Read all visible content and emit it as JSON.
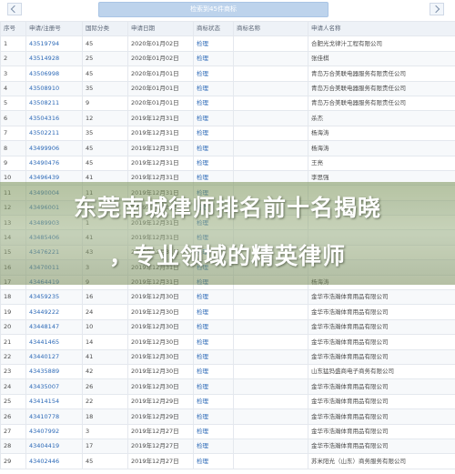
{
  "search_banner": "检索到45件商标",
  "table": {
    "headers": [
      "序号",
      "申请/注册号",
      "国际分类",
      "申请日期",
      "商标状态",
      "商标名称",
      "申请人名称"
    ],
    "rows": [
      [
        "1",
        "43519794",
        "45",
        "2020年01月02日",
        "检理",
        "",
        "合肥光戈律汁工程有限公司"
      ],
      [
        "2",
        "43514928",
        "25",
        "2020年01月02日",
        "检理",
        "",
        "张佳棋"
      ],
      [
        "3",
        "43506998",
        "45",
        "2020年01月01日",
        "检理",
        "",
        "青岛万合美联电器服务有限责任公司"
      ],
      [
        "4",
        "43508910",
        "35",
        "2020年01月01日",
        "检理",
        "",
        "青岛万合美联电器服务有限责任公司"
      ],
      [
        "5",
        "43508211",
        "9",
        "2020年01月01日",
        "检理",
        "",
        "青岛万合美联电器服务有限责任公司"
      ],
      [
        "6",
        "43504316",
        "12",
        "2019年12月31日",
        "检理",
        "",
        "杀杰"
      ],
      [
        "7",
        "43502211",
        "35",
        "2019年12月31日",
        "检理",
        "",
        "杨海涛"
      ],
      [
        "8",
        "43499906",
        "45",
        "2019年12月31日",
        "检理",
        "",
        "杨海涛"
      ],
      [
        "9",
        "43490476",
        "45",
        "2019年12月31日",
        "检理",
        "",
        "王亮"
      ],
      [
        "10",
        "43496439",
        "41",
        "2019年12月31日",
        "检理",
        "",
        "李思强"
      ],
      [
        "11",
        "43490004",
        "11",
        "2019年12月31日",
        "检理",
        "",
        ""
      ],
      [
        "12",
        "43496001",
        "20",
        "2019年12月31日",
        "检理",
        "",
        ""
      ],
      [
        "13",
        "43489903",
        "1",
        "2019年12月31日",
        "检理",
        "",
        ""
      ],
      [
        "14",
        "43485406",
        "41",
        "2019年12月31日",
        "检理",
        "",
        ""
      ],
      [
        "15",
        "43476221",
        "43",
        "2019年12月31日",
        "检理",
        "",
        ""
      ],
      [
        "16",
        "43470011",
        "3",
        "2019年12月31日",
        "检理",
        "",
        ""
      ],
      [
        "17",
        "43464419",
        "9",
        "2019年12月31日",
        "检理",
        "",
        "杨海涛"
      ],
      [
        "18",
        "43459235",
        "16",
        "2019年12月30日",
        "检理",
        "",
        "金华市浩瀚体育用品有限公司"
      ],
      [
        "19",
        "43449222",
        "24",
        "2019年12月30日",
        "检理",
        "",
        "金华市浩瀚体育用品有限公司"
      ],
      [
        "20",
        "43448147",
        "10",
        "2019年12月30日",
        "检理",
        "",
        "金华市浩瀚体育用品有限公司"
      ],
      [
        "21",
        "43441465",
        "14",
        "2019年12月30日",
        "检理",
        "",
        "金华市浩瀚体育用品有限公司"
      ],
      [
        "22",
        "43440127",
        "41",
        "2019年12月30日",
        "检理",
        "",
        "金华市浩瀚体育用品有限公司"
      ],
      [
        "23",
        "43435889",
        "42",
        "2019年12月30日",
        "检理",
        "",
        "山东猛犸盛商电子商务有限公司"
      ],
      [
        "24",
        "43435007",
        "26",
        "2019年12月30日",
        "检理",
        "",
        "金华市浩瀚体育用品有限公司"
      ],
      [
        "25",
        "43414154",
        "22",
        "2019年12月29日",
        "检理",
        "",
        "金华市浩瀚体育用品有限公司"
      ],
      [
        "26",
        "43410778",
        "18",
        "2019年12月29日",
        "检理",
        "",
        "金华市浩瀚体育用品有限公司"
      ],
      [
        "27",
        "43407992",
        "3",
        "2019年12月27日",
        "检理",
        "",
        "金华市浩瀚体育用品有限公司"
      ],
      [
        "28",
        "43404419",
        "17",
        "2019年12月27日",
        "检理",
        "",
        "金华市浩瀚体育用品有限公司"
      ],
      [
        "29",
        "43402446",
        "45",
        "2019年12月27日",
        "检理",
        "",
        "苏米阳光（山东）商务服务有限公司"
      ]
    ]
  },
  "headline": {
    "line1": "东莞南城律师排名前十名揭晓",
    "line2": "，专业领域的精英律师"
  }
}
